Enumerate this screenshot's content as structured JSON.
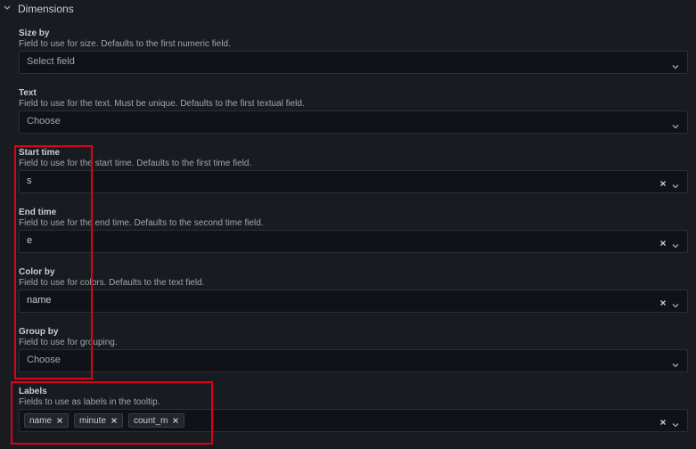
{
  "section": {
    "title": "Dimensions"
  },
  "fields": {
    "size_by": {
      "label": "Size by",
      "description": "Field to use for size. Defaults to the first numeric field.",
      "value": "Select field"
    },
    "text": {
      "label": "Text",
      "description": "Field to use for the text. Must be unique. Defaults to the first textual field.",
      "value": "Choose"
    },
    "start_time": {
      "label": "Start time",
      "description": "Field to use for the start time. Defaults to the first time field.",
      "value": "s"
    },
    "end_time": {
      "label": "End time",
      "description": "Field to use for the end time. Defaults to the second time field.",
      "value": "e"
    },
    "color_by": {
      "label": "Color by",
      "description": "Field to use for colors. Defaults to the text field.",
      "value": "name"
    },
    "group_by": {
      "label": "Group by",
      "description": "Field to use for grouping.",
      "value": "Choose"
    },
    "labels": {
      "label": "Labels",
      "description": "Fields to use as labels in the tooltip.",
      "chips": [
        "name",
        "minute",
        "count_m"
      ]
    }
  },
  "colors": {
    "background": "#181b1f",
    "input_bg": "#111217",
    "highlight": "#e0001a"
  },
  "icons": {
    "collapse": "chevron-down-icon",
    "clear": "close-icon",
    "dropdown": "chevron-down-icon"
  }
}
